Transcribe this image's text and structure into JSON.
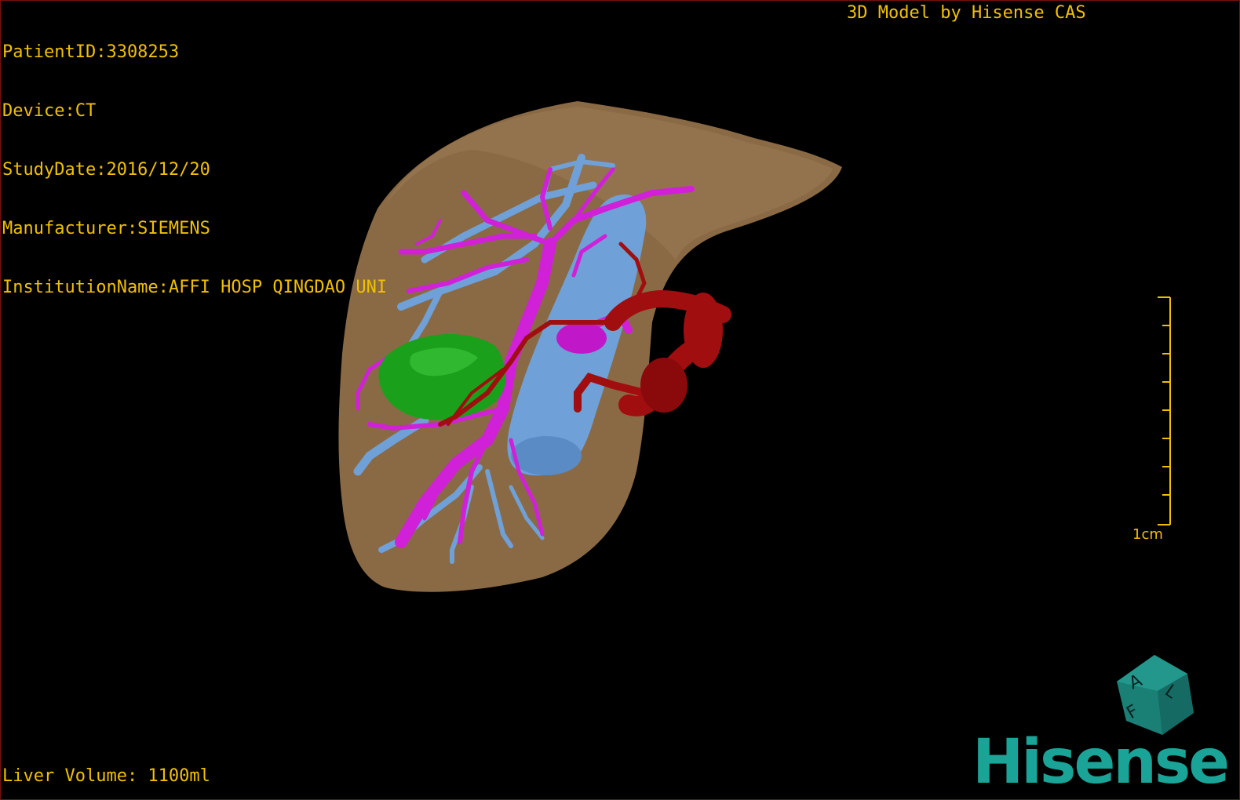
{
  "info": {
    "patient_id": "PatientID:3308253",
    "device": "Device:CT",
    "study_date": "StudyDate:2016/12/20",
    "manufacturer": "Manufacturer:SIEMENS",
    "institution": "InstitutionName:AFFI HOSP QINGDAO UNI"
  },
  "title": "3D Model by Hisense CAS",
  "footer": {
    "liver_volume": "Liver Volume: 1100ml"
  },
  "scale": {
    "label": "1cm"
  },
  "orientation_cube": {
    "labels": [
      "A",
      "F",
      "L"
    ]
  },
  "logo": {
    "text": "Hisense"
  },
  "colors": {
    "text": "#f0c000",
    "liver": "#8a6a45",
    "portal_vein": "#d020d8",
    "hepatic_vein": "#6fa0d8",
    "artery": "#a00e10",
    "tumor": "#1aa01a",
    "logo": "#1aa397"
  }
}
